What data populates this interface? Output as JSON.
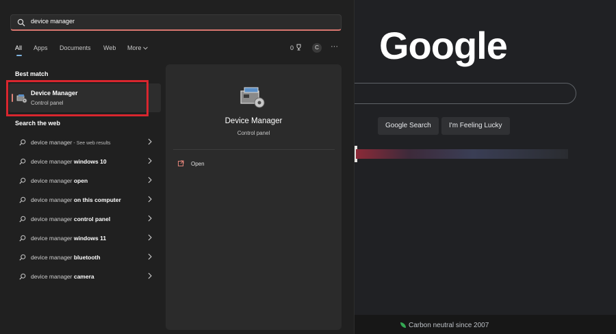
{
  "browser": {
    "logo_text": "Google",
    "search_button": "Google Search",
    "lucky_button": "I'm Feeling Lucky",
    "footer_text": "Carbon neutral since 2007"
  },
  "search": {
    "query": "device manager"
  },
  "tabs": [
    {
      "label": "All"
    },
    {
      "label": "Apps"
    },
    {
      "label": "Documents"
    },
    {
      "label": "Web"
    },
    {
      "label": "More"
    }
  ],
  "toolbar": {
    "points": "0",
    "avatar_initial": "C",
    "more_label": "···"
  },
  "best_match": {
    "heading": "Best match",
    "title": "Device Manager",
    "subtitle": "Control panel"
  },
  "web": {
    "heading": "Search the web",
    "results": [
      {
        "prefix": "device manager",
        "bold": "",
        "suffix": " - See web results"
      },
      {
        "prefix": "device manager ",
        "bold": "windows 10",
        "suffix": ""
      },
      {
        "prefix": "device manager ",
        "bold": "open",
        "suffix": ""
      },
      {
        "prefix": "device manager ",
        "bold": "on this computer",
        "suffix": ""
      },
      {
        "prefix": "device manager ",
        "bold": "control panel",
        "suffix": ""
      },
      {
        "prefix": "device manager ",
        "bold": "windows 11",
        "suffix": ""
      },
      {
        "prefix": "device manager ",
        "bold": "bluetooth",
        "suffix": ""
      },
      {
        "prefix": "device manager ",
        "bold": "camera",
        "suffix": ""
      }
    ]
  },
  "detail": {
    "title": "Device Manager",
    "subtitle": "Control panel",
    "actions": [
      {
        "label": "Open"
      }
    ]
  },
  "colors": {
    "accent": "#e08378",
    "highlight_box": "#d9262e",
    "panel_bg": "#202020"
  }
}
